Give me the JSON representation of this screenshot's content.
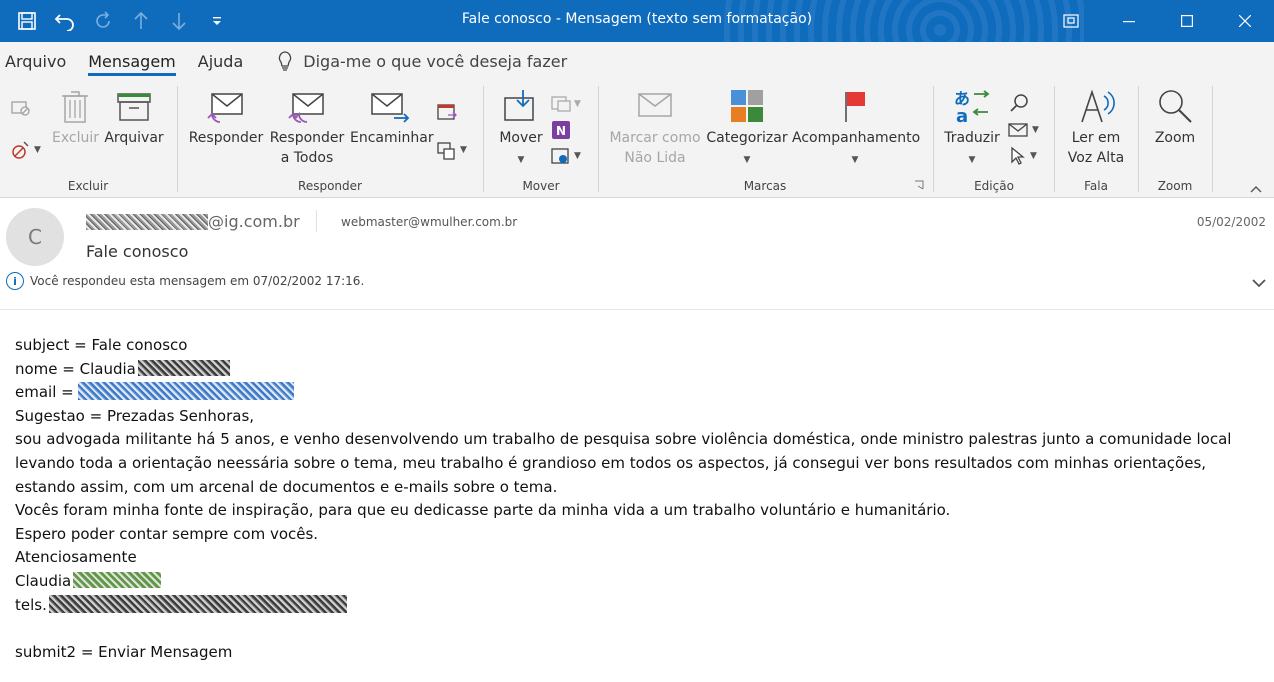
{
  "window": {
    "title": "Fale conosco  -  Mensagem (texto sem formatação)",
    "controls": [
      "restore-down",
      "minimize",
      "maximize",
      "close"
    ]
  },
  "quick_access": [
    "save-icon",
    "undo-icon",
    "redo-icon",
    "up-icon",
    "down-icon",
    "customize-icon"
  ],
  "tabs": [
    {
      "label": "Arquivo",
      "active": false
    },
    {
      "label": "Mensagem",
      "active": true
    },
    {
      "label": "Ajuda",
      "active": false
    }
  ],
  "tell_me": "Diga-me o que você deseja fazer",
  "ribbon": {
    "excluir": {
      "label": "Excluir",
      "buttons": {
        "delete": "Excluir",
        "archive": "Arquivar"
      }
    },
    "responder": {
      "label": "Responder",
      "buttons": {
        "reply": "Responder",
        "reply_all_1": "Responder",
        "reply_all_2": "a Todos",
        "forward": "Encaminhar"
      }
    },
    "mover": {
      "label": "Mover",
      "buttons": {
        "move": "Mover"
      }
    },
    "marcas": {
      "label": "Marcas",
      "buttons": {
        "mark_unread_1": "Marcar como",
        "mark_unread_2": "Não Lida",
        "categorize": "Categorizar",
        "followup": "Acompanhamento"
      }
    },
    "edicao": {
      "label": "Edição",
      "buttons": {
        "translate": "Traduzir"
      }
    },
    "fala": {
      "label": "Fala",
      "buttons": {
        "read_aloud_1": "Ler em",
        "read_aloud_2": "Voz Alta"
      }
    },
    "zoom": {
      "label": "Zoom",
      "buttons": {
        "zoom": "Zoom"
      }
    }
  },
  "message": {
    "avatar_initial": "C",
    "from_domain": "@ig.com.br",
    "to": "webmaster@wmulher.com.br",
    "date": "05/02/2002",
    "subject": "Fale conosco",
    "info": "Você respondeu esta mensagem em 07/02/2002 17:16."
  },
  "body": {
    "subject_line": "subject = Fale conosco",
    "nome_prefix": "nome = Claudia",
    "email_prefix": "email = ",
    "sugestao": "Sugestao = Prezadas Senhoras,",
    "p1": "sou advogada militante há 5 anos, e venho desenvolvendo um trabalho de pesquisa sobre violência doméstica, onde ministro palestras junto a comunidade local",
    "p2": "levando toda a orientação neessária sobre o tema, meu trabalho é grandioso em todos os aspectos, já consegui ver bons resultados com minhas orientações,",
    "p3": "estando assim,  com um arcenal de documentos e e-mails sobre o tema.",
    "p4": "Vocês foram minha fonte de inspiração, para que eu dedicasse parte da minha vida a um trabalho voluntário e humanitário.",
    "p5": "Espero poder contar sempre com vocês.",
    "closing": "Atenciosamente",
    "sign": "Claudia",
    "tels_prefix": "tels.",
    "submit": "submit2 = Enviar Mensagem"
  },
  "colors": {
    "accent": "#0f6cbd",
    "ribbon_bg": "#f3f3f3"
  }
}
